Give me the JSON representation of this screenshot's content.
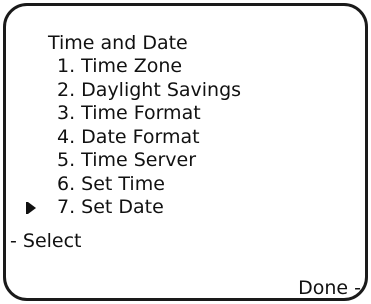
{
  "screen": {
    "title": "Time and Date",
    "menu": {
      "items": [
        {
          "label": "1. Time Zone"
        },
        {
          "label": "2. Daylight Savings"
        },
        {
          "label": "3. Time Format"
        },
        {
          "label": "4. Date Format"
        },
        {
          "label": "5. Time Server"
        },
        {
          "label": "6. Set Time"
        },
        {
          "label": "7. Set Date"
        }
      ],
      "selected_index": 6,
      "cursor_icon": "arrow-right-icon"
    },
    "softkeys": {
      "left_label": "- Select",
      "right_label": "Done -"
    }
  }
}
